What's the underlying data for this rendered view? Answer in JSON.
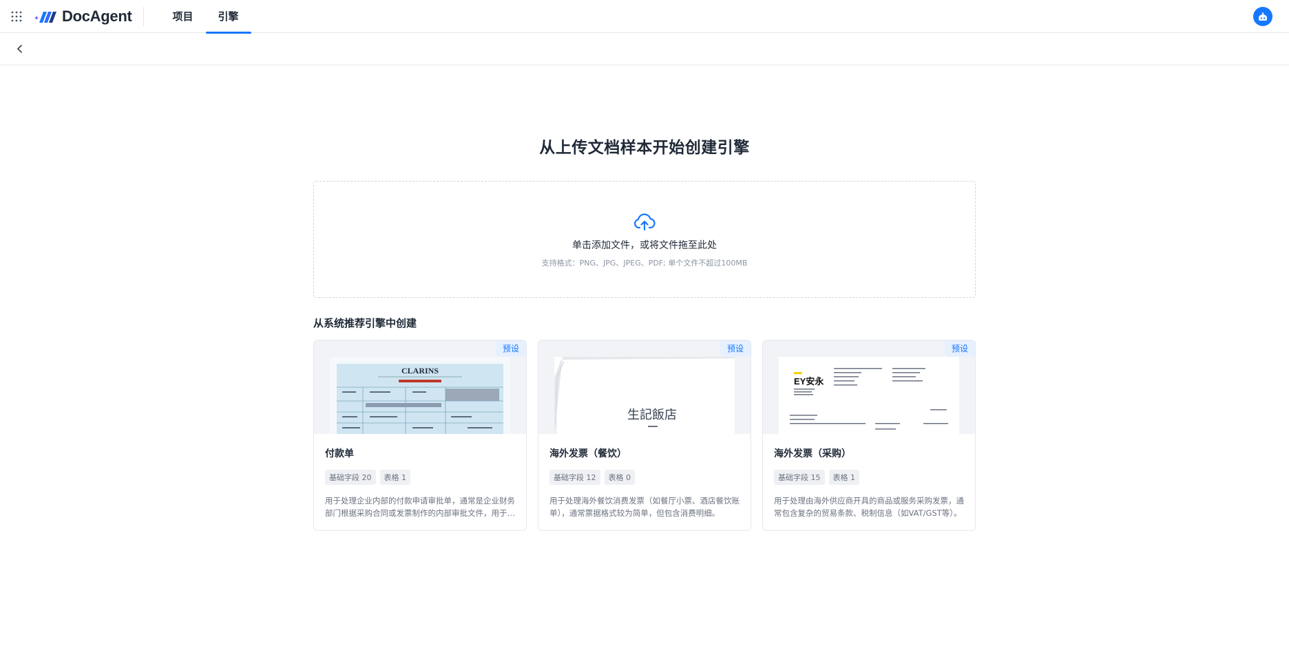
{
  "app": {
    "name": "DocAgent"
  },
  "nav": {
    "items": [
      {
        "label": "项目"
      },
      {
        "label": "引擎"
      }
    ],
    "active_index": 1
  },
  "colors": {
    "accent": "#1677ff",
    "text": "#1f2937",
    "muted": "#6b7280"
  },
  "main": {
    "title": "从上传文档样本开始创建引擎",
    "upload": {
      "main_text": "单击添加文件，或将文件拖至此处",
      "sub_text": "支持格式：PNG、JPG、JPEG、PDF; 单个文件不超过100MB"
    },
    "section_title": "从系统推荐引擎中创建",
    "cards": [
      {
        "badge": "预设",
        "title": "付款单",
        "tag_fields": "基础字段 20",
        "tag_tables": "表格 1",
        "desc": "用于处理企业内部的付款申请审批单，通常是企业财务部门根据采购合同或发票制作的内部审批文件，用于付款审批流程。",
        "thumb_text": "CLARINS"
      },
      {
        "badge": "预设",
        "title": "海外发票（餐饮）",
        "tag_fields": "基础字段 12",
        "tag_tables": "表格 0",
        "desc": "用于处理海外餐饮消费发票（如餐厅小票、酒店餐饮账单），通常票据格式较为简单，但包含消费明细。",
        "thumb_text": "生記飯店"
      },
      {
        "badge": "预设",
        "title": "海外发票（采购）",
        "tag_fields": "基础字段 15",
        "tag_tables": "表格 1",
        "desc": "用于处理由海外供应商开具的商品或服务采购发票，通常包含复杂的贸易条款、税制信息（如VAT/GST等）。",
        "thumb_text": "EY安永"
      }
    ]
  }
}
